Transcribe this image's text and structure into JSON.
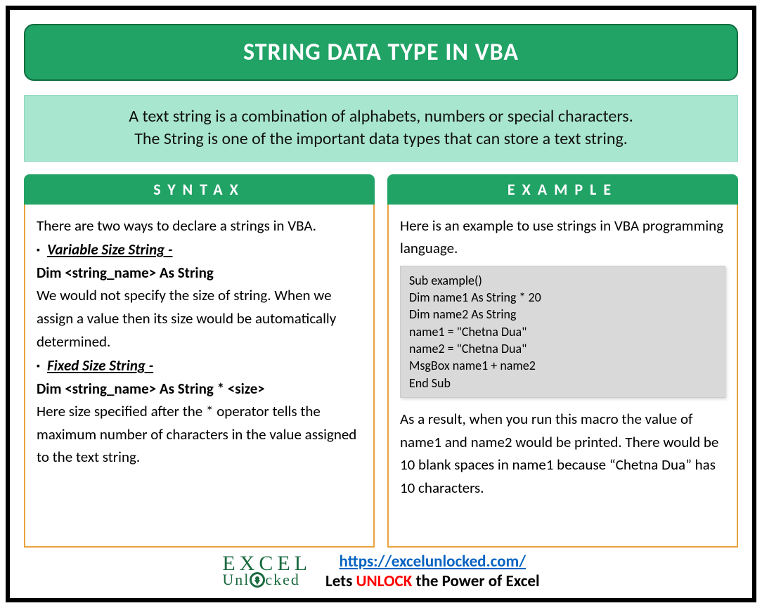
{
  "title": "STRING DATA TYPE IN VBA",
  "intro_line1": "A text string is a combination of alphabets, numbers or special characters.",
  "intro_line2": "The String is one of the important data types that can store a text string.",
  "syntax": {
    "header": "SYNTAX",
    "lead": "There are two ways to declare a strings in VBA.",
    "item1_title": "Variable Size String -",
    "item1_code": "Dim <string_name> As String",
    "item1_desc": "We would not specify the size of string. When we assign a value then its size would be automatically determined.",
    "item2_title": "Fixed Size String -",
    "item2_code": "Dim <string_name> As String * <size>",
    "item2_desc": "Here size specified after the * operator tells the maximum number of characters in the value assigned to the text string."
  },
  "example": {
    "header": "EXAMPLE",
    "lead": "Here is an example to use strings in VBA programming language.",
    "code": "Sub example()\nDim name1 As String * 20\nDim name2 As String\nname1 = \"Chetna Dua\"\nname2 = \"Chetna Dua\"\nMsgBox name1 + name2\nEnd Sub",
    "result": "As a result, when you run this macro the value of name1 and name2 would be printed. There would be 10 blank spaces in name1 because “Chetna Dua” has 10 characters."
  },
  "footer": {
    "logo_line1": "EXCEL",
    "logo_line2_a": "Unl",
    "logo_line2_b": "cked",
    "url": "https://excelunlocked.com/",
    "tagline_a": "Lets ",
    "tagline_b": "UNLOCK",
    "tagline_c": " the Power of Excel"
  }
}
